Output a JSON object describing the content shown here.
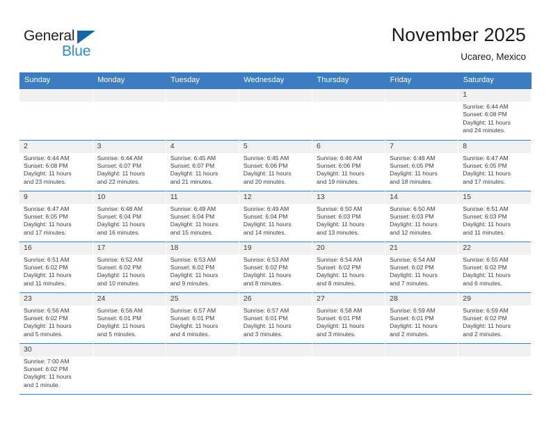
{
  "brand": {
    "name_part1": "General",
    "name_part2": "Blue",
    "flag_icon": "brand-flag-icon"
  },
  "header": {
    "title": "November 2025",
    "subtitle": "Ucareo, Mexico"
  },
  "colors": {
    "header_blue": "#3b7dc0",
    "brand_blue": "#2f89cd",
    "flag_blue": "#1565a8",
    "daynum_bg": "#f0f0f0",
    "text": "#3c3c3c"
  },
  "weekdays": [
    "Sunday",
    "Monday",
    "Tuesday",
    "Wednesday",
    "Thursday",
    "Friday",
    "Saturday"
  ],
  "weeks": [
    [
      {
        "day": "",
        "lines": []
      },
      {
        "day": "",
        "lines": []
      },
      {
        "day": "",
        "lines": []
      },
      {
        "day": "",
        "lines": []
      },
      {
        "day": "",
        "lines": []
      },
      {
        "day": "",
        "lines": []
      },
      {
        "day": "1",
        "lines": [
          "Sunrise: 6:44 AM",
          "Sunset: 6:08 PM",
          "Daylight: 11 hours",
          "and 24 minutes."
        ]
      }
    ],
    [
      {
        "day": "2",
        "lines": [
          "Sunrise: 6:44 AM",
          "Sunset: 6:08 PM",
          "Daylight: 11 hours",
          "and 23 minutes."
        ]
      },
      {
        "day": "3",
        "lines": [
          "Sunrise: 6:44 AM",
          "Sunset: 6:07 PM",
          "Daylight: 11 hours",
          "and 22 minutes."
        ]
      },
      {
        "day": "4",
        "lines": [
          "Sunrise: 6:45 AM",
          "Sunset: 6:07 PM",
          "Daylight: 11 hours",
          "and 21 minutes."
        ]
      },
      {
        "day": "5",
        "lines": [
          "Sunrise: 6:45 AM",
          "Sunset: 6:06 PM",
          "Daylight: 11 hours",
          "and 20 minutes."
        ]
      },
      {
        "day": "6",
        "lines": [
          "Sunrise: 6:46 AM",
          "Sunset: 6:06 PM",
          "Daylight: 11 hours",
          "and 19 minutes."
        ]
      },
      {
        "day": "7",
        "lines": [
          "Sunrise: 6:46 AM",
          "Sunset: 6:05 PM",
          "Daylight: 11 hours",
          "and 18 minutes."
        ]
      },
      {
        "day": "8",
        "lines": [
          "Sunrise: 6:47 AM",
          "Sunset: 6:05 PM",
          "Daylight: 11 hours",
          "and 17 minutes."
        ]
      }
    ],
    [
      {
        "day": "9",
        "lines": [
          "Sunrise: 6:47 AM",
          "Sunset: 6:05 PM",
          "Daylight: 11 hours",
          "and 17 minutes."
        ]
      },
      {
        "day": "10",
        "lines": [
          "Sunrise: 6:48 AM",
          "Sunset: 6:04 PM",
          "Daylight: 11 hours",
          "and 16 minutes."
        ]
      },
      {
        "day": "11",
        "lines": [
          "Sunrise: 6:49 AM",
          "Sunset: 6:04 PM",
          "Daylight: 11 hours",
          "and 15 minutes."
        ]
      },
      {
        "day": "12",
        "lines": [
          "Sunrise: 6:49 AM",
          "Sunset: 6:04 PM",
          "Daylight: 11 hours",
          "and 14 minutes."
        ]
      },
      {
        "day": "13",
        "lines": [
          "Sunrise: 6:50 AM",
          "Sunset: 6:03 PM",
          "Daylight: 11 hours",
          "and 13 minutes."
        ]
      },
      {
        "day": "14",
        "lines": [
          "Sunrise: 6:50 AM",
          "Sunset: 6:03 PM",
          "Daylight: 11 hours",
          "and 12 minutes."
        ]
      },
      {
        "day": "15",
        "lines": [
          "Sunrise: 6:51 AM",
          "Sunset: 6:03 PM",
          "Daylight: 11 hours",
          "and 11 minutes."
        ]
      }
    ],
    [
      {
        "day": "16",
        "lines": [
          "Sunrise: 6:51 AM",
          "Sunset: 6:02 PM",
          "Daylight: 11 hours",
          "and 11 minutes."
        ]
      },
      {
        "day": "17",
        "lines": [
          "Sunrise: 6:52 AM",
          "Sunset: 6:02 PM",
          "Daylight: 11 hours",
          "and 10 minutes."
        ]
      },
      {
        "day": "18",
        "lines": [
          "Sunrise: 6:53 AM",
          "Sunset: 6:02 PM",
          "Daylight: 11 hours",
          "and 9 minutes."
        ]
      },
      {
        "day": "19",
        "lines": [
          "Sunrise: 6:53 AM",
          "Sunset: 6:02 PM",
          "Daylight: 11 hours",
          "and 8 minutes."
        ]
      },
      {
        "day": "20",
        "lines": [
          "Sunrise: 6:54 AM",
          "Sunset: 6:02 PM",
          "Daylight: 11 hours",
          "and 8 minutes."
        ]
      },
      {
        "day": "21",
        "lines": [
          "Sunrise: 6:54 AM",
          "Sunset: 6:02 PM",
          "Daylight: 11 hours",
          "and 7 minutes."
        ]
      },
      {
        "day": "22",
        "lines": [
          "Sunrise: 6:55 AM",
          "Sunset: 6:02 PM",
          "Daylight: 11 hours",
          "and 6 minutes."
        ]
      }
    ],
    [
      {
        "day": "23",
        "lines": [
          "Sunrise: 6:56 AM",
          "Sunset: 6:02 PM",
          "Daylight: 11 hours",
          "and 5 minutes."
        ]
      },
      {
        "day": "24",
        "lines": [
          "Sunrise: 6:56 AM",
          "Sunset: 6:01 PM",
          "Daylight: 11 hours",
          "and 5 minutes."
        ]
      },
      {
        "day": "25",
        "lines": [
          "Sunrise: 6:57 AM",
          "Sunset: 6:01 PM",
          "Daylight: 11 hours",
          "and 4 minutes."
        ]
      },
      {
        "day": "26",
        "lines": [
          "Sunrise: 6:57 AM",
          "Sunset: 6:01 PM",
          "Daylight: 11 hours",
          "and 3 minutes."
        ]
      },
      {
        "day": "27",
        "lines": [
          "Sunrise: 6:58 AM",
          "Sunset: 6:01 PM",
          "Daylight: 11 hours",
          "and 3 minutes."
        ]
      },
      {
        "day": "28",
        "lines": [
          "Sunrise: 6:59 AM",
          "Sunset: 6:01 PM",
          "Daylight: 11 hours",
          "and 2 minutes."
        ]
      },
      {
        "day": "29",
        "lines": [
          "Sunrise: 6:59 AM",
          "Sunset: 6:02 PM",
          "Daylight: 11 hours",
          "and 2 minutes."
        ]
      }
    ],
    [
      {
        "day": "30",
        "lines": [
          "Sunrise: 7:00 AM",
          "Sunset: 6:02 PM",
          "Daylight: 11 hours",
          "and 1 minute."
        ]
      },
      {
        "day": "",
        "lines": []
      },
      {
        "day": "",
        "lines": []
      },
      {
        "day": "",
        "lines": []
      },
      {
        "day": "",
        "lines": []
      },
      {
        "day": "",
        "lines": []
      },
      {
        "day": "",
        "lines": []
      }
    ]
  ]
}
